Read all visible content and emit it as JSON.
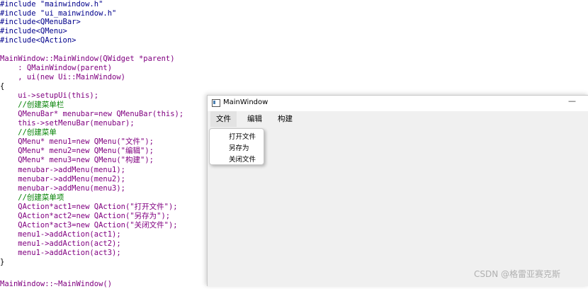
{
  "code": {
    "l1": "#include \"mainwindow.h\"",
    "l2": "#include \"ui_mainwindow.h\"",
    "l3": "#include<QMenuBar>",
    "l4": "#include<QMenu>",
    "l5": "#include<QAction>",
    "l7": "MainWindow::MainWindow(QWidget *parent)",
    "l8": "    : QMainWindow(parent)",
    "l9": "    , ui(new Ui::MainWindow)",
    "l10": "{",
    "l11": "    ui->setupUi(this);",
    "l12": "    //创建菜单栏",
    "l13": "    QMenuBar* menubar=new QMenuBar(this);",
    "l14": "    this->setMenuBar(menubar);",
    "l15": "    //创建菜单",
    "l16": "    QMenu* menu1=new QMenu(\"文件\");",
    "l17": "    QMenu* menu2=new QMenu(\"编辑\");",
    "l18": "    QMenu* menu3=new QMenu(\"构建\");",
    "l19": "    menubar->addMenu(menu1);",
    "l20": "    menubar->addMenu(menu2);",
    "l21": "    menubar->addMenu(menu3);",
    "l22": "    //创建菜单项",
    "l23": "    QAction*act1=new QAction(\"打开文件\");",
    "l24": "    QAction*act2=new QAction(\"另存为\");",
    "l25": "    QAction*act3=new QAction(\"关闭文件\");",
    "l26": "    menu1->addAction(act1);",
    "l27": "    menu1->addAction(act2);",
    "l28": "    menu1->addAction(act3);",
    "l29": "}",
    "l31": "MainWindow::~MainWindow()"
  },
  "window": {
    "title": "MainWindow",
    "minimize": "—",
    "menus": [
      "文件",
      "编辑",
      "构建"
    ],
    "dropdown_items": [
      "打开文件",
      "另存为",
      "关闭文件"
    ]
  },
  "watermark": "CSDN @格雷亚赛克斯",
  "colors": {
    "keyword": "#800080",
    "string": "#008000",
    "type": "#800080",
    "comment": "#008000"
  }
}
